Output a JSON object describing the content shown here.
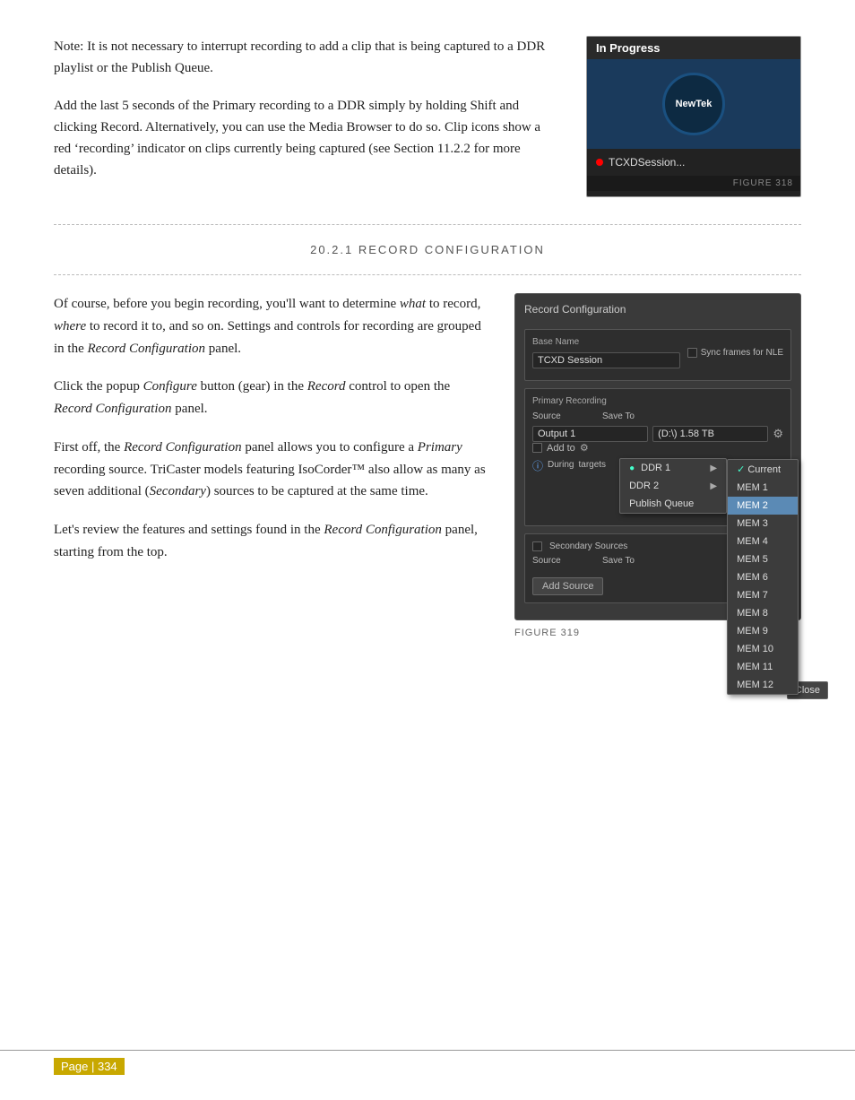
{
  "page": {
    "number": "Page | 334"
  },
  "top_note": {
    "paragraph1": "Note: It is not necessary to interrupt recording to add a clip that is being captured to a DDR playlist or the Publish Queue.",
    "paragraph2": "Add the last 5 seconds of the Primary recording to a DDR simply by holding Shift and clicking Record. Alternatively, you can use the Media Browser to do so.   Clip icons show a red ‘recording’ indicator on clips currently being captured (see Section 11.2.2 for more details)."
  },
  "figure318": {
    "header": "In Progress",
    "logo": "NewTek",
    "status": "TCXDSession...",
    "label": "FIGURE 318"
  },
  "section": {
    "title": "20.2.1 RECORD CONFIGURATION"
  },
  "record_text": {
    "p1": "Of course, before you begin recording, you’ll want to determine what to record, where to record it to, and so on. Settings and controls for recording are grouped in the Record Configuration panel.",
    "p2": "Click the popup Configure button (gear) in the Record control to open the Record Configuration panel.",
    "p3": "First off, the Record Configuration panel allows you to configure a Primary recording source. TriCaster models featuring IsoCorder™ also allow as many as seven additional (Secondary) sources to be captured at the same time.",
    "p4": "Let’s review the features and settings found in the Record Configuration panel, starting from the top."
  },
  "panel": {
    "title": "Record Configuration",
    "base_name_label": "Base Name",
    "base_name_value": "TCXD Session",
    "sync_label": "Sync frames for NLE",
    "primary_recording_label": "Primary Recording",
    "source_label": "Source",
    "save_to_label": "Save To",
    "output_value": "Output 1",
    "save_path": "(D:\\) 1.58 TB",
    "add_to_label": "Add to",
    "during_label": "During",
    "targets_label": "targets",
    "secondary_label": "Secondary Sources",
    "source_label2": "Source",
    "save_to_label2": "Save To",
    "add_source_btn": "Add Source"
  },
  "menu": {
    "ddr1": "DDR 1",
    "ddr2": "DDR 2",
    "publish_queue": "Publish Queue"
  },
  "submenu": {
    "items": [
      "✓ Current",
      "MEM 1",
      "MEM 2",
      "MEM 3",
      "MEM 4",
      "MEM 5",
      "MEM 6",
      "MEM 7",
      "MEM 8",
      "MEM 9",
      "MEM 10",
      "MEM 11",
      "MEM 12"
    ],
    "highlighted_index": 2
  },
  "figure319": {
    "label": "FIGURE 319"
  },
  "close_btn": "Close"
}
